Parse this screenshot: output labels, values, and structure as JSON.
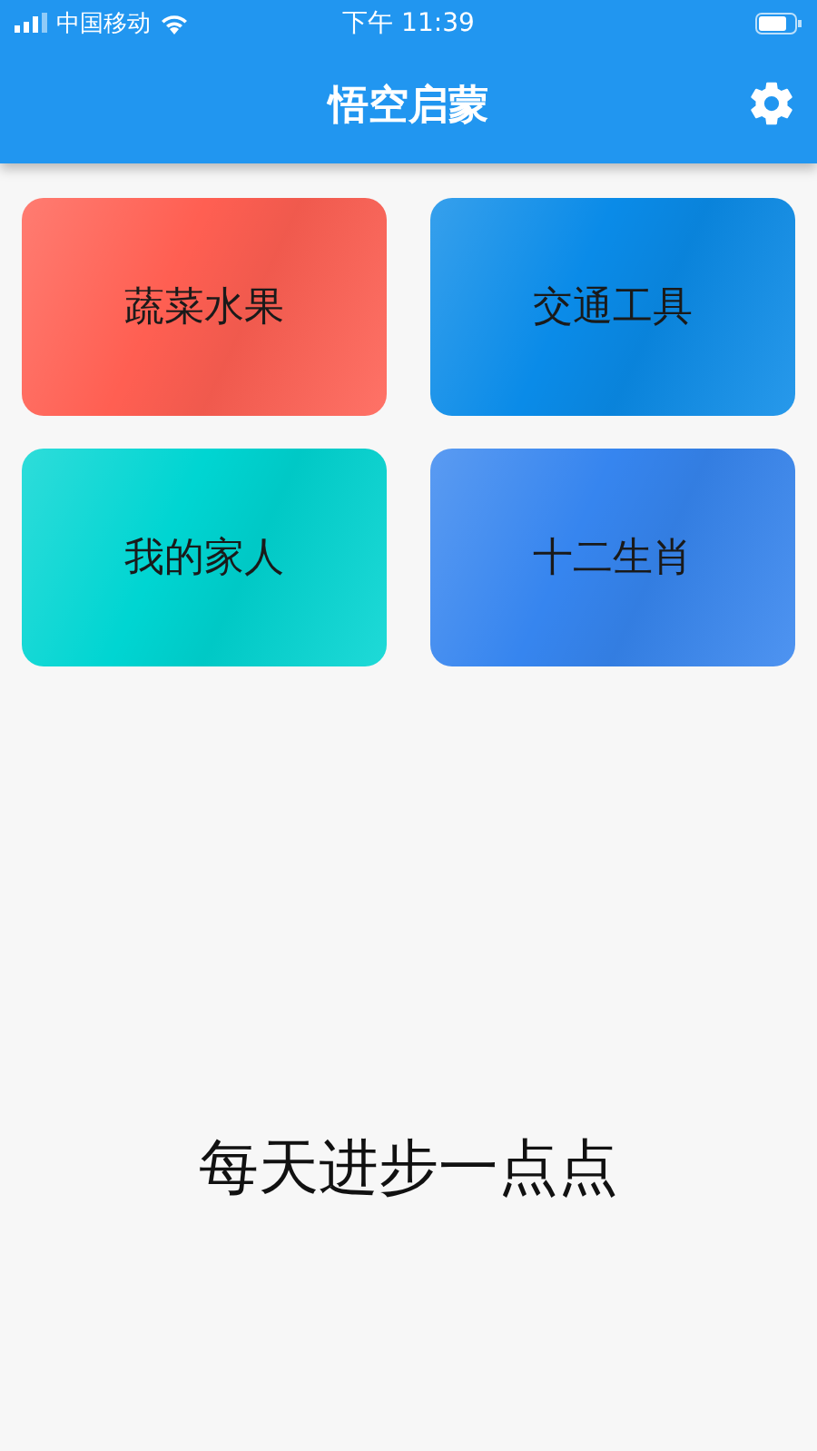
{
  "status_bar": {
    "carrier": "中国移动",
    "time": "下午 11:39"
  },
  "header": {
    "title": "悟空启蒙"
  },
  "cards": [
    {
      "label": "蔬菜水果",
      "color": "#ff5f52"
    },
    {
      "label": "交通工具",
      "color": "#0a8be8"
    },
    {
      "label": "我的家人",
      "color": "#00d5d2"
    },
    {
      "label": "十二生肖",
      "color": "#3685ef"
    }
  ],
  "tagline": "每天进步一点点"
}
